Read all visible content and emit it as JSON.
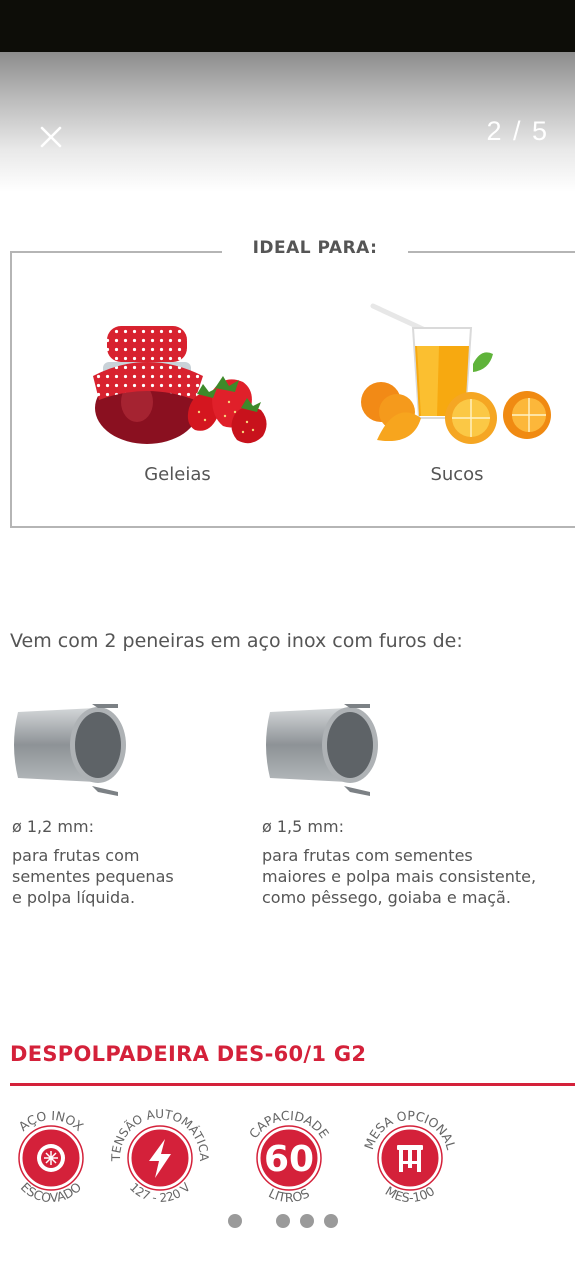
{
  "viewer": {
    "page_counter": "2 / 5",
    "current_page": 2,
    "total_pages": 5,
    "close_icon": "close-icon",
    "dot_count": 4
  },
  "ideal": {
    "title": "IDEAL PARA:",
    "items": [
      {
        "label": "Geleias",
        "image": "strawberry-jam-jar"
      },
      {
        "label": "Sucos",
        "image": "orange-juice-glass"
      }
    ]
  },
  "sieves": {
    "intro": "Vem com 2 peneiras em aço inox com furos de:",
    "items": [
      {
        "size": "ø 1,2 mm:",
        "lines": [
          "para frutas com",
          "sementes pequenas",
          "e polpa líquida."
        ]
      },
      {
        "size": "ø 1,5 mm:",
        "lines": [
          "para frutas com sementes",
          "maiores e polpa mais consistente,",
          "como pêssego, goiaba e maçã."
        ]
      }
    ]
  },
  "product": {
    "title": "DESPOLPADEIRA DES-60/1 G2",
    "badges": [
      {
        "top": "AÇO INOX",
        "bottom": "ESCOVADO",
        "center": "",
        "icon": "steel-emblem-icon"
      },
      {
        "top": "TENSÃO AUTOMÁTICA",
        "bottom": "127 - 220 V",
        "center": "",
        "icon": "lightning-bolt-icon"
      },
      {
        "top": "CAPACIDADE",
        "bottom": "LITROS",
        "center": "60",
        "icon": ""
      },
      {
        "top": "MESA OPCIONAL",
        "bottom": "MES-100",
        "center": "",
        "icon": "stool-icon"
      }
    ]
  },
  "colors": {
    "brand_red": "#d4213a",
    "text_gray": "#555555",
    "border_gray": "#b5b5b5"
  }
}
